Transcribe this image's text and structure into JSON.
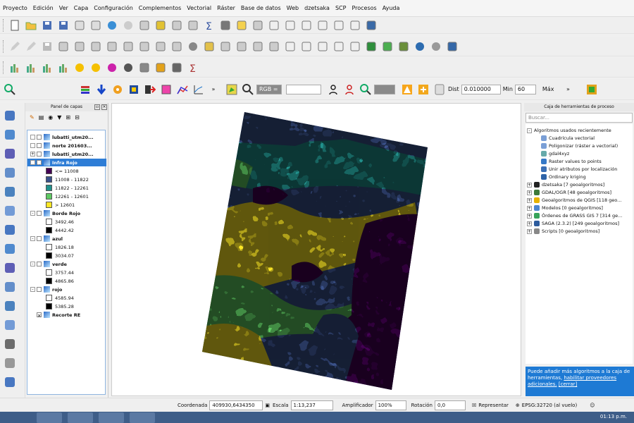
{
  "menu": [
    "Proyecto",
    "Edición",
    "Ver",
    "Capa",
    "Configuración",
    "Complementos",
    "Vectorial",
    "Ráster",
    "Base de datos",
    "Web",
    "dzetsaka",
    "SCP",
    "Procesos",
    "Ayuda"
  ],
  "scp_toolbar": {
    "band_select": "RGB =",
    "band_value": "",
    "dist_label": "Dist",
    "dist_value": "0.010000",
    "min_label": "Min",
    "min_value": "60",
    "max_label": "Máx"
  },
  "layers_panel": {
    "title": "Panel de capas",
    "layers": [
      {
        "name": "lubatti_utm20...",
        "bold": true,
        "checked": false,
        "expand": ""
      },
      {
        "name": "norte 201603...",
        "bold": true,
        "checked": false,
        "expand": ""
      },
      {
        "name": "lubatti_utm20...",
        "bold": true,
        "checked": false,
        "expand": "+"
      },
      {
        "name": "Infra Rojo",
        "bold": true,
        "checked": true,
        "expand": "-",
        "selected": true
      }
    ],
    "infrarojo_classes": [
      {
        "label": "<= 11008",
        "color": "#440154"
      },
      {
        "label": "11008 - 11822",
        "color": "#3b528b"
      },
      {
        "label": "11822 - 12261",
        "color": "#21918c"
      },
      {
        "label": "12261 - 12601",
        "color": "#5ec962"
      },
      {
        "label": "> 12601",
        "color": "#fde725"
      }
    ],
    "bands": [
      {
        "name": "Borde Rojo",
        "max": "3492.46",
        "min": "4442.42"
      },
      {
        "name": "azul",
        "max": "1826.18",
        "min": "3034.07"
      },
      {
        "name": "verde",
        "max": "3757.44",
        "min": "4865.86"
      },
      {
        "name": "rojo",
        "max": "4585.94",
        "min": "5385.28"
      }
    ],
    "last_layer": "Recorte RE"
  },
  "toolbox": {
    "title": "Caja de herramientas de proceso",
    "search_placeholder": "Buscar...",
    "recent_group": "Algoritmos usados recientemente",
    "recent": [
      "Cuadrícula vectorial",
      "Poligonizar (ráster a vectorial)",
      "gdal4xyz",
      "Raster values to points",
      "Unir atributos por localización",
      "Ordinary kriging"
    ],
    "groups": [
      "dzetsaka [7 geoalgoritmos]",
      "GDAL/OGR [48 geoalgoritmos]",
      "Geoalgoritmos de QGIS [118 geo...",
      "Modelos [0 geoalgoritmos]",
      "Órdenes de GRASS GIS 7 [314 ge...",
      "SAGA (2.3.2) [249 geoalgoritmos]",
      "Scripts [0 geoalgoritmos]"
    ],
    "info_text": "Puede añadir más algoritmos a la caja de herramientas,",
    "info_link1": "habilitar proveedores adicionales.",
    "info_link2": "[cerrar]"
  },
  "statusbar": {
    "coord_label": "Coordenada",
    "coord_value": "409930,6434350",
    "scale_label": "Escala",
    "scale_value": "1:13,237",
    "mag_label": "Amplificador",
    "mag_value": "100%",
    "rot_label": "Rotación",
    "rot_value": "0,0",
    "render_label": "Representar",
    "crs": "EPSG:32720 (al vuelo)"
  },
  "taskbar": {
    "time": "01:13 p.m."
  },
  "colors": {
    "c1": "#440154",
    "c2": "#3b528b",
    "c3": "#21918c",
    "c4": "#5ec962",
    "c5": "#fde725",
    "selection": "#2e7dd6"
  }
}
